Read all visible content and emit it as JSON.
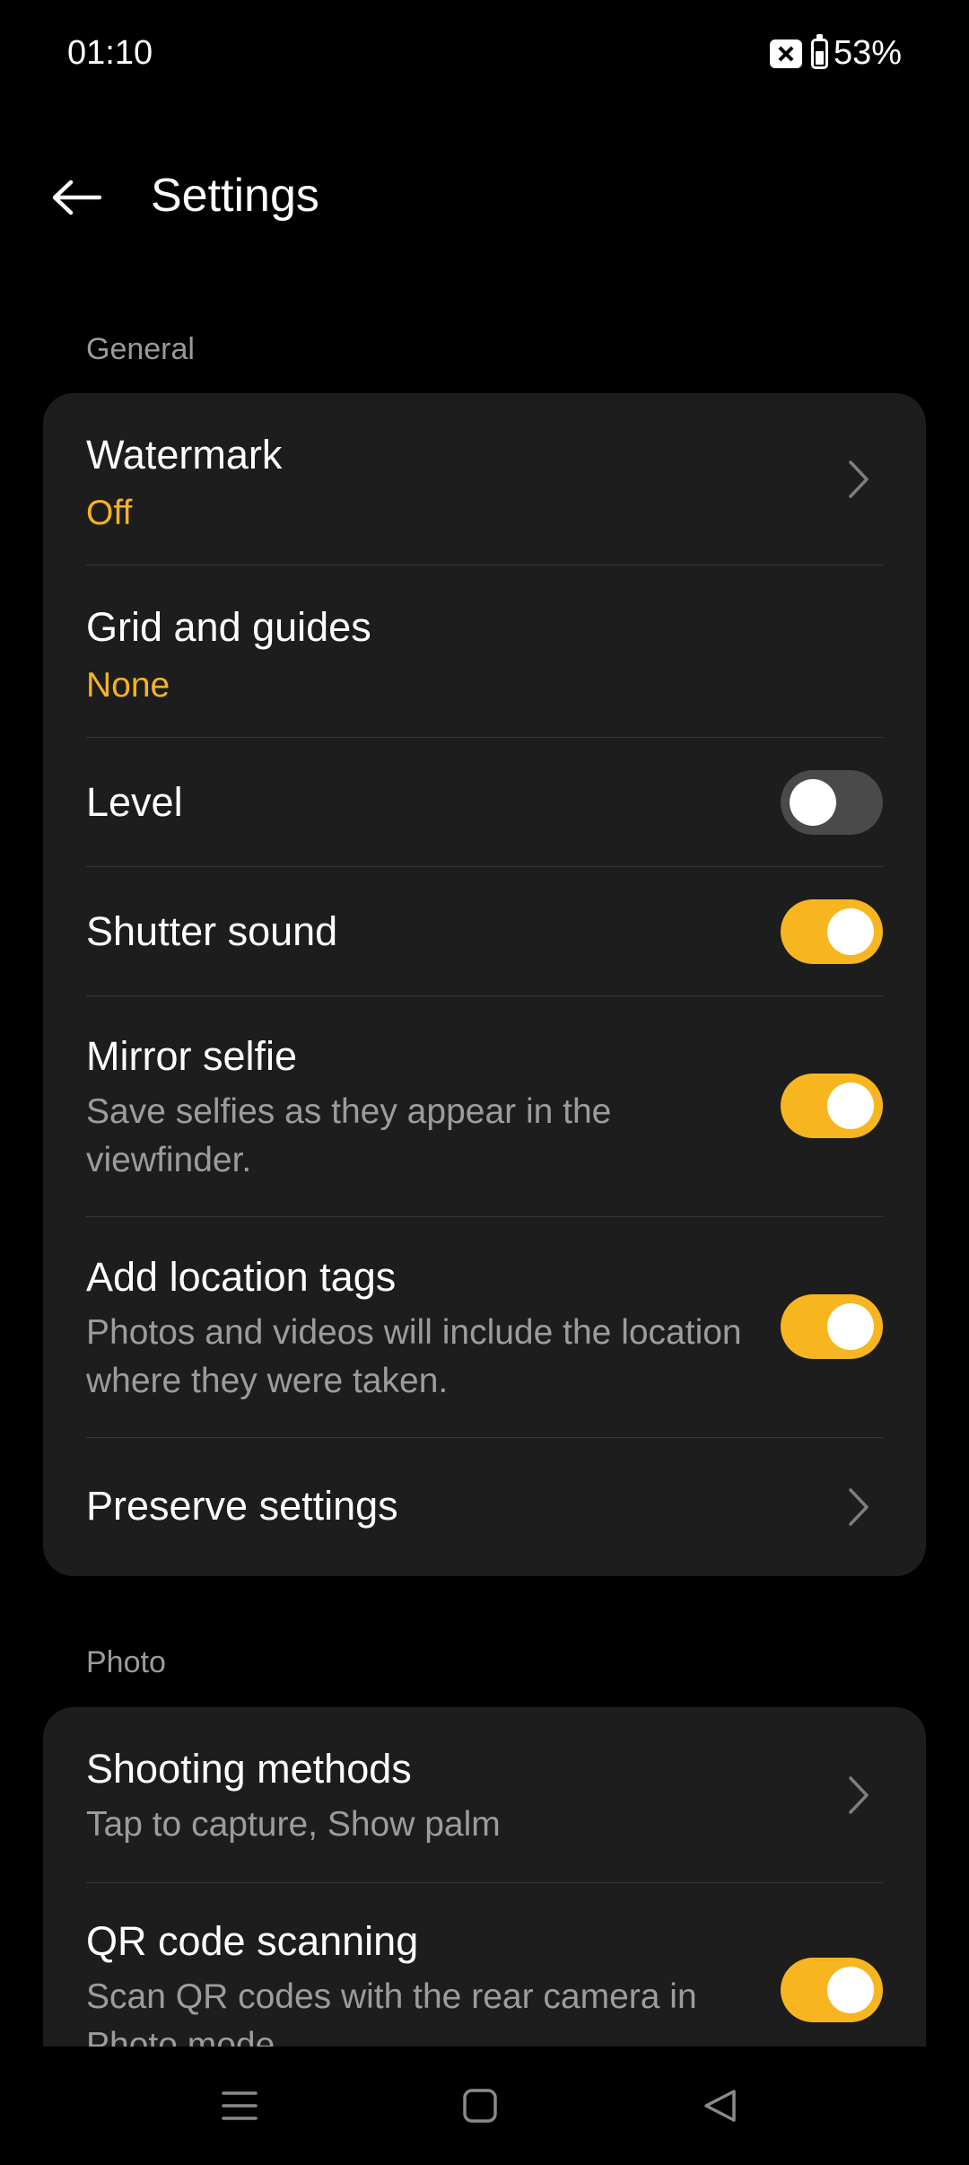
{
  "status_bar": {
    "time": "01:10",
    "battery_percent": "53%",
    "battery_level": 0.53
  },
  "header": {
    "title": "Settings"
  },
  "sections": [
    {
      "label": "General",
      "items": [
        {
          "title": "Watermark",
          "value": "Off",
          "control": "chevron"
        },
        {
          "title": "Grid and guides",
          "value": "None",
          "control": "none"
        },
        {
          "title": "Level",
          "control": "toggle",
          "enabled": false
        },
        {
          "title": "Shutter sound",
          "control": "toggle",
          "enabled": true
        },
        {
          "title": "Mirror selfie",
          "description": "Save selfies as they appear in the viewfinder.",
          "control": "toggle",
          "enabled": true
        },
        {
          "title": "Add location tags",
          "description": "Photos and videos will include the location where they were taken.",
          "control": "toggle",
          "enabled": true
        },
        {
          "title": "Preserve settings",
          "control": "chevron"
        }
      ]
    },
    {
      "label": "Photo",
      "items": [
        {
          "title": "Shooting methods",
          "description": "Tap to capture, Show palm",
          "control": "chevron"
        },
        {
          "title": "QR code scanning",
          "description": "Scan QR codes with the rear camera in Photo mode.",
          "control": "toggle",
          "enabled": true
        }
      ]
    }
  ],
  "icons": {
    "back": "arrow-left-icon",
    "chevron": "chevron-right-icon",
    "nav_menu": "menu-icon",
    "nav_home": "square-home-icon",
    "nav_back": "triangle-back-icon",
    "sim": "no-sim-icon",
    "battery": "battery-icon"
  },
  "colors": {
    "accent": "#f7b51f",
    "background": "#000000",
    "card": "#1d1d1d",
    "secondary_text": "#9c9c9c",
    "toggle_off": "#4a4a4a"
  }
}
